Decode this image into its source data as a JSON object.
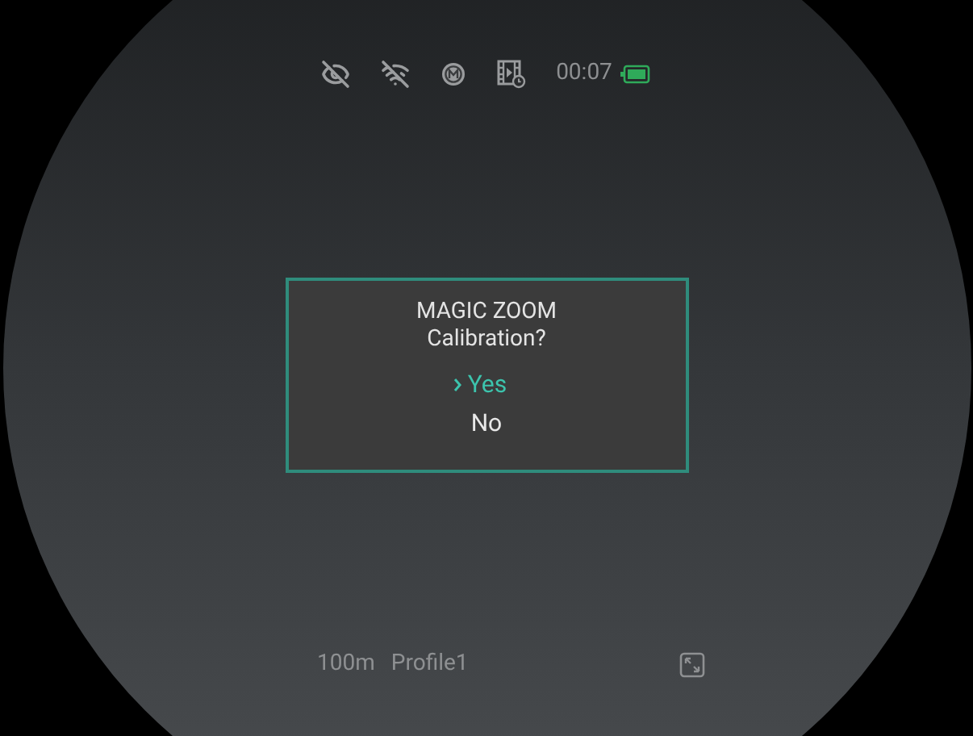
{
  "status_bar": {
    "time": "00:07"
  },
  "dialog": {
    "title": "MAGIC ZOOM",
    "question": "Calibration?",
    "options": [
      {
        "label": "Yes",
        "selected": true
      },
      {
        "label": "No",
        "selected": false
      }
    ]
  },
  "bottom_bar": {
    "distance": "100m",
    "profile": "Profile1"
  }
}
